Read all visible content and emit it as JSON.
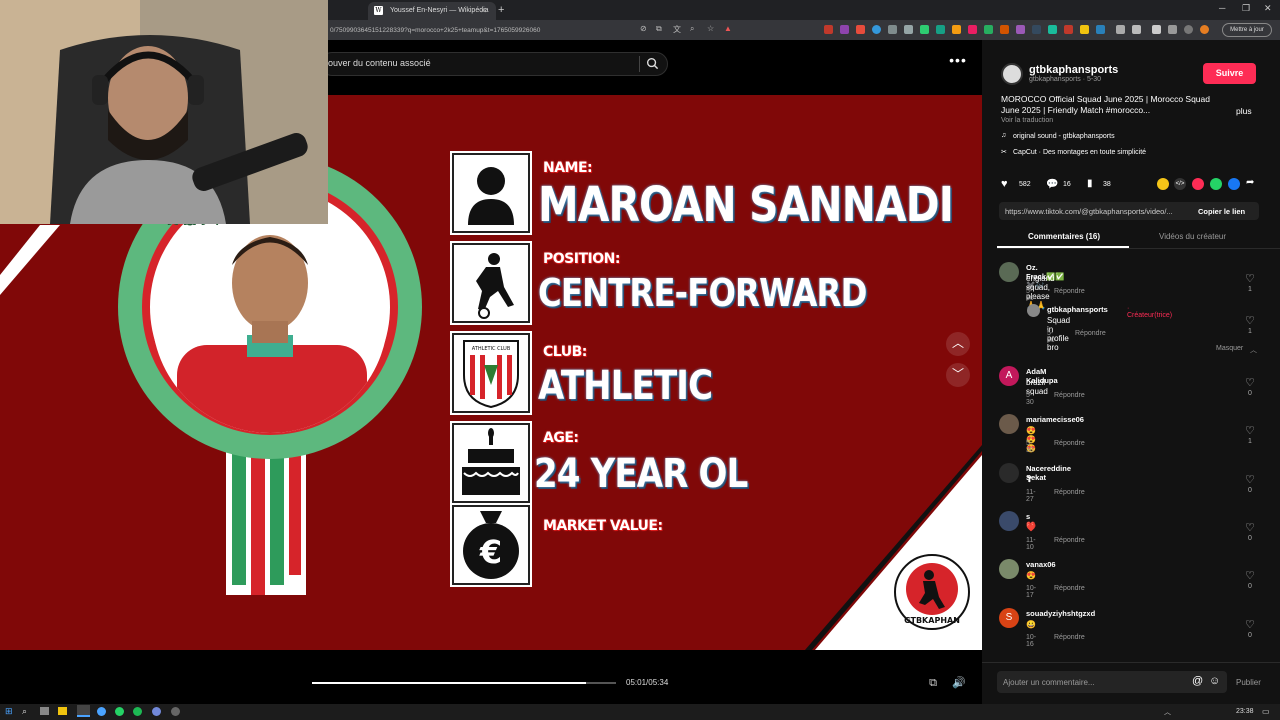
{
  "browser": {
    "tab_title": "Youssef En-Nesyri — Wikipédia",
    "url": "0/7509903645151228339?q=morocco+2k25+teamup&t=1765059926060",
    "update_label": "Mettre à jour"
  },
  "search": {
    "placeholder": "ouver du contenu associé"
  },
  "video": {
    "labels": {
      "name": "NAME:",
      "position": "POSITION:",
      "club": "CLUB:",
      "age": "AGE:",
      "market": "MARKET VALUE:"
    },
    "values": {
      "name": "MAROAN SANNADI",
      "position": "CENTRE-FORWARD",
      "club": "ATHLETIC",
      "age": "24 YEAR OL"
    },
    "club_badge_text": "ATHLETIC CLUB",
    "logo_text": "GTBKAPHAN",
    "euro_symbol": "€",
    "time": "05:01/05:34",
    "progress": 0.9
  },
  "post": {
    "username": "gtbkaphansports",
    "subline": "gtbkaphansports · 5-30",
    "follow_label": "Suivre",
    "description": "MOROCCO Official Squad June 2025 | Morocco Squad June 2025 | Friendly Match #morocco...",
    "more_label": "plus",
    "translate_label": "Voir la traduction",
    "sound": "original sound - gtbkaphansports",
    "capcut": "CapCut · Des montages en toute simplicité",
    "likes": "582",
    "comments": "16",
    "saves": "38",
    "link": "https://www.tiktok.com/@gtbkaphansports/video/...",
    "copy_label": "Copier le lien"
  },
  "tabs": {
    "comments": "Commentaires (16)",
    "creator": "Vidéos du créateur"
  },
  "comments": [
    {
      "user": "Oz. Frack✅✅ ✖️🎶",
      "text": "england squad, please🙏🙏",
      "date": "5-30",
      "likes": "1",
      "avatar_color": "#5a6a55"
    },
    {
      "user": "gtbkaphansports",
      "creator_tag": "· Créateur(trice)",
      "text": "Squad in profile bro",
      "date": "5-30",
      "likes": "1",
      "avatar_color": "#888"
    },
    {
      "user": "AdaM Kalidupa",
      "text": "brazil squad",
      "date": "5-30",
      "likes": "0",
      "avatar_color": "#c2185b",
      "initial": "A"
    },
    {
      "user": "mariamecisse06",
      "text": "😍😍😍",
      "date": "5-30",
      "likes": "1",
      "avatar_color": "#6b5a4a"
    },
    {
      "user": "Nacereddine Sekat",
      "text": "❣",
      "date": "11-27",
      "likes": "0",
      "avatar_color": "#2a2a2a"
    },
    {
      "user": "s❤️",
      "text": "❤️",
      "date": "11-10",
      "likes": "0",
      "avatar_color": "#3a4a6a"
    },
    {
      "user": "vanax06",
      "text": "😍",
      "date": "10-17",
      "likes": "0",
      "avatar_color": "#7a8a6a"
    },
    {
      "user": "souadyziyhshtgzxd",
      "text": "😀",
      "date": "10-16",
      "likes": "0",
      "avatar_color": "#d84315",
      "initial": "S"
    }
  ],
  "reply_label": "Répondre",
  "hide_label": "Masquer",
  "comment_input": {
    "placeholder": "Ajouter un commentaire...",
    "publish": "Publier"
  },
  "clock": "23:38"
}
